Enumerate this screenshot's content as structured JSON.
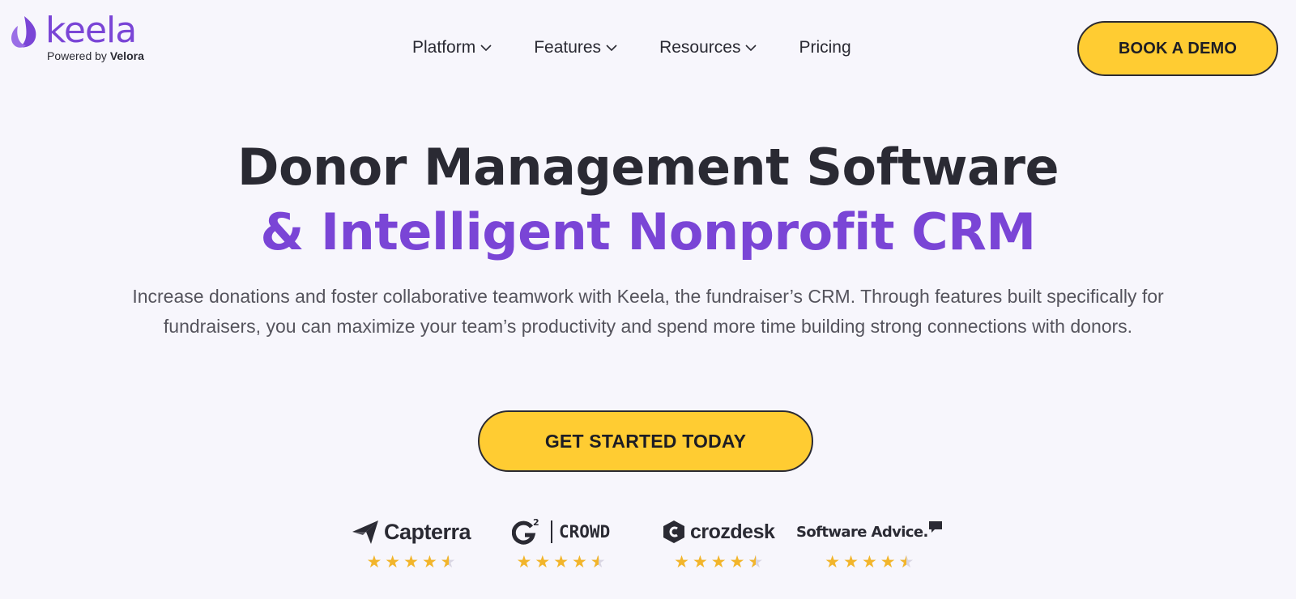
{
  "header": {
    "logo_text": "keela",
    "logo_sub_prefix": "Powered by",
    "logo_sub_brand": "Velora",
    "nav": [
      {
        "label": "Platform",
        "has_dropdown": true
      },
      {
        "label": "Features",
        "has_dropdown": true
      },
      {
        "label": "Resources",
        "has_dropdown": true
      },
      {
        "label": "Pricing",
        "has_dropdown": false
      }
    ],
    "cta_label": "BOOK A DEMO"
  },
  "hero": {
    "title_line1": "Donor Management Software",
    "title_line2": "& Intelligent Nonprofit CRM",
    "description": "Increase donations and foster collaborative teamwork with Keela, the fundraiser’s CRM. Through features built specifically for fundraisers, you can maximize your team’s productivity and spend more time building strong connections with donors.",
    "cta_label": "GET STARTED TODAY"
  },
  "reviews": [
    {
      "site": "Capterra",
      "logo_text": "Capterra",
      "rating": 4.5,
      "icon": "capterra-arrow-icon"
    },
    {
      "site": "G2 Crowd",
      "logo_text": "CROWD",
      "logo_mark": "G",
      "logo_sup": "2",
      "rating": 4.5,
      "icon": "g2-logo-icon"
    },
    {
      "site": "Crozdesk",
      "logo_text": "crozdesk",
      "rating": 4.5,
      "icon": "crozdesk-logo-icon"
    },
    {
      "site": "Software Advice",
      "logo_text": "Software Advice.",
      "rating": 4.5,
      "icon": "speech-bubble-icon"
    }
  ],
  "colors": {
    "background": "#f7f6fc",
    "brand_purple": "#7a45d6",
    "cta_yellow": "#ffcc32",
    "text_dark": "#2a2a33",
    "star": "#f2b52b"
  }
}
